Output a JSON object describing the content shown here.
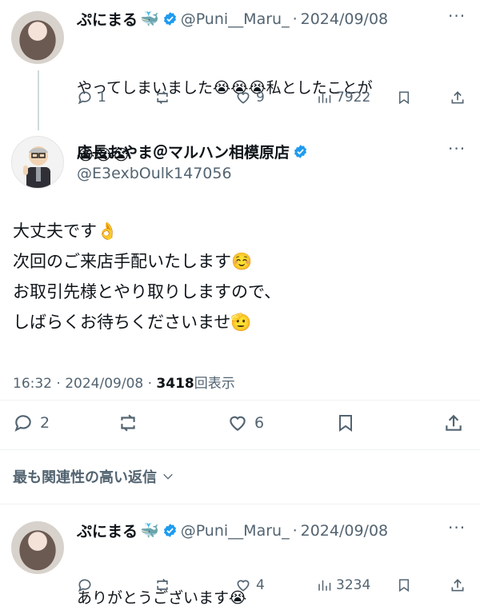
{
  "tweet1": {
    "display_name": "ぷにまる",
    "name_emoji": "🐳",
    "handle": "@Puni__Maru_",
    "separator": "·",
    "date": "2024/09/08",
    "text_line1": "やってしまいました😭😭😭私としたことが",
    "text_line2": "😭😭😭",
    "replies": "1",
    "likes": "9",
    "views": "7922"
  },
  "main_tweet": {
    "display_name": "店長おやま＠マルハン相模原店",
    "handle": "@E3exbOulk147056",
    "line1": "大丈夫です👌",
    "line2": "次回のご来店手配いたします☺️",
    "line3": "お取引先様とやり取りしますので、",
    "line4": "しばらくお待ちくださいませ🫡",
    "time": "16:32",
    "separator": "·",
    "date": "2024/09/08",
    "views_count": "3418",
    "views_label": "回表示",
    "replies": "2",
    "likes": "6"
  },
  "replies_sort_label": "最も関連性の高い返信",
  "tweet2": {
    "display_name": "ぷにまる",
    "name_emoji": "🐳",
    "handle": "@Puni__Maru_",
    "separator": "·",
    "date": "2024/09/08",
    "text": "ありがとうございます😭",
    "likes": "4",
    "views": "3234"
  },
  "colors": {
    "text": "#0f1419",
    "secondary": "#536471",
    "verified": "#1d9bf0",
    "divider": "#eff3f4"
  }
}
